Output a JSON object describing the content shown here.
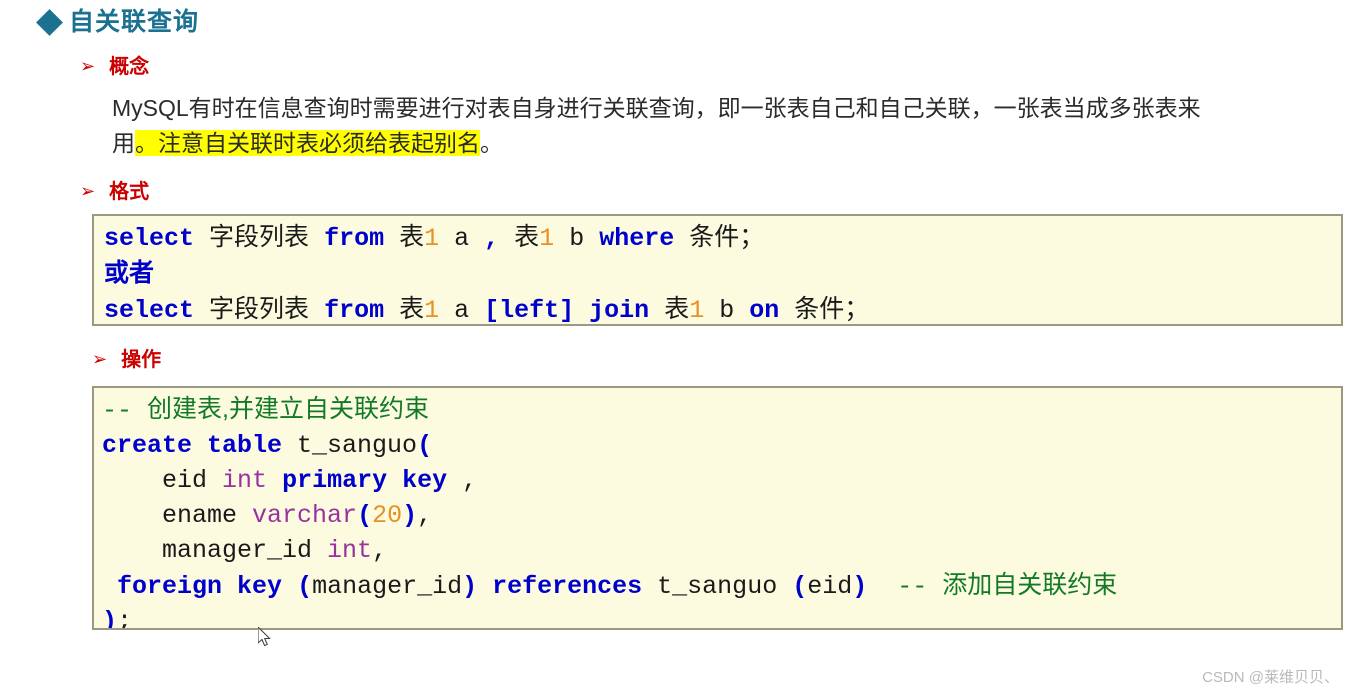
{
  "section": {
    "bullet_icon": "diamond-icon",
    "title": "自关联查询",
    "title_color": "#1b7190"
  },
  "headings": {
    "arrow_icon": "➢",
    "arrow_color": "#cc0000",
    "concept": "概念",
    "format": "格式",
    "operation": "操作"
  },
  "concept": {
    "text_before_highlight": "MySQL有时在信息查询时需要进行对表自身进行关联查询，即一张表自己和自己关联，一张表当成多张表来用",
    "highlight": "。注意自关联时表必须给表起别名",
    "text_after_highlight": "。",
    "highlight_color": "#ffff00"
  },
  "format_code": {
    "lines": [
      [
        {
          "t": "select",
          "c": "kw"
        },
        {
          "t": " ",
          "c": "plain"
        },
        {
          "t": "字段列表",
          "c": "cjk"
        },
        {
          "t": " ",
          "c": "plain"
        },
        {
          "t": "from",
          "c": "kw"
        },
        {
          "t": " ",
          "c": "plain"
        },
        {
          "t": "表",
          "c": "cjk"
        },
        {
          "t": "1",
          "c": "num"
        },
        {
          "t": " a ",
          "c": "plain"
        },
        {
          "t": ",",
          "c": "pun"
        },
        {
          "t": " ",
          "c": "plain"
        },
        {
          "t": "表",
          "c": "cjk"
        },
        {
          "t": "1",
          "c": "num"
        },
        {
          "t": " b ",
          "c": "plain"
        },
        {
          "t": "where",
          "c": "kw"
        },
        {
          "t": " ",
          "c": "plain"
        },
        {
          "t": "条件；",
          "c": "cjk"
        }
      ],
      [
        {
          "t": "或者",
          "c": "cjk-kw"
        }
      ],
      [
        {
          "t": "select",
          "c": "kw"
        },
        {
          "t": " ",
          "c": "plain"
        },
        {
          "t": "字段列表",
          "c": "cjk"
        },
        {
          "t": " ",
          "c": "plain"
        },
        {
          "t": "from",
          "c": "kw"
        },
        {
          "t": " ",
          "c": "plain"
        },
        {
          "t": "表",
          "c": "cjk"
        },
        {
          "t": "1",
          "c": "num"
        },
        {
          "t": " a ",
          "c": "plain"
        },
        {
          "t": "[left]",
          "c": "kw"
        },
        {
          "t": " ",
          "c": "plain"
        },
        {
          "t": "join",
          "c": "kw"
        },
        {
          "t": " ",
          "c": "plain"
        },
        {
          "t": "表",
          "c": "cjk"
        },
        {
          "t": "1",
          "c": "num"
        },
        {
          "t": " b ",
          "c": "plain"
        },
        {
          "t": "on",
          "c": "kw"
        },
        {
          "t": " ",
          "c": "plain"
        },
        {
          "t": "条件；",
          "c": "cjk"
        }
      ]
    ]
  },
  "operation_code": {
    "lines": [
      [
        {
          "t": "-- ",
          "c": "cmt"
        },
        {
          "t": "创建表,并建立自关联约束",
          "c": "cjk-cmt"
        }
      ],
      [
        {
          "t": "create table",
          "c": "kw"
        },
        {
          "t": " t_sanguo",
          "c": "plain"
        },
        {
          "t": "(",
          "c": "pun"
        }
      ],
      [
        {
          "t": "    eid ",
          "c": "plain"
        },
        {
          "t": "int",
          "c": "typ"
        },
        {
          "t": " ",
          "c": "plain"
        },
        {
          "t": "primary key",
          "c": "kw"
        },
        {
          "t": " ,",
          "c": "plain"
        }
      ],
      [
        {
          "t": "    ename ",
          "c": "plain"
        },
        {
          "t": "varchar",
          "c": "typ"
        },
        {
          "t": "(",
          "c": "pun"
        },
        {
          "t": "20",
          "c": "num"
        },
        {
          "t": ")",
          "c": "pun"
        },
        {
          "t": ",",
          "c": "plain"
        }
      ],
      [
        {
          "t": "    manager_id ",
          "c": "plain"
        },
        {
          "t": "int",
          "c": "typ"
        },
        {
          "t": ",",
          "c": "plain"
        }
      ],
      [
        {
          "t": " ",
          "c": "plain"
        },
        {
          "t": "foreign key",
          "c": "kw"
        },
        {
          "t": " ",
          "c": "plain"
        },
        {
          "t": "(",
          "c": "pun"
        },
        {
          "t": "manager_id",
          "c": "plain"
        },
        {
          "t": ")",
          "c": "pun"
        },
        {
          "t": " ",
          "c": "plain"
        },
        {
          "t": "references",
          "c": "kw"
        },
        {
          "t": " t_sanguo ",
          "c": "plain"
        },
        {
          "t": "(",
          "c": "pun"
        },
        {
          "t": "eid",
          "c": "plain"
        },
        {
          "t": ")",
          "c": "pun"
        },
        {
          "t": "  ",
          "c": "plain"
        },
        {
          "t": "-- ",
          "c": "cmt"
        },
        {
          "t": "添加自关联约束",
          "c": "cjk-cmt"
        }
      ],
      [
        {
          "t": ")",
          "c": "pun"
        },
        {
          "t": ";",
          "c": "plain"
        }
      ]
    ]
  },
  "watermark": {
    "text": "CSDN @莱维贝贝、"
  }
}
